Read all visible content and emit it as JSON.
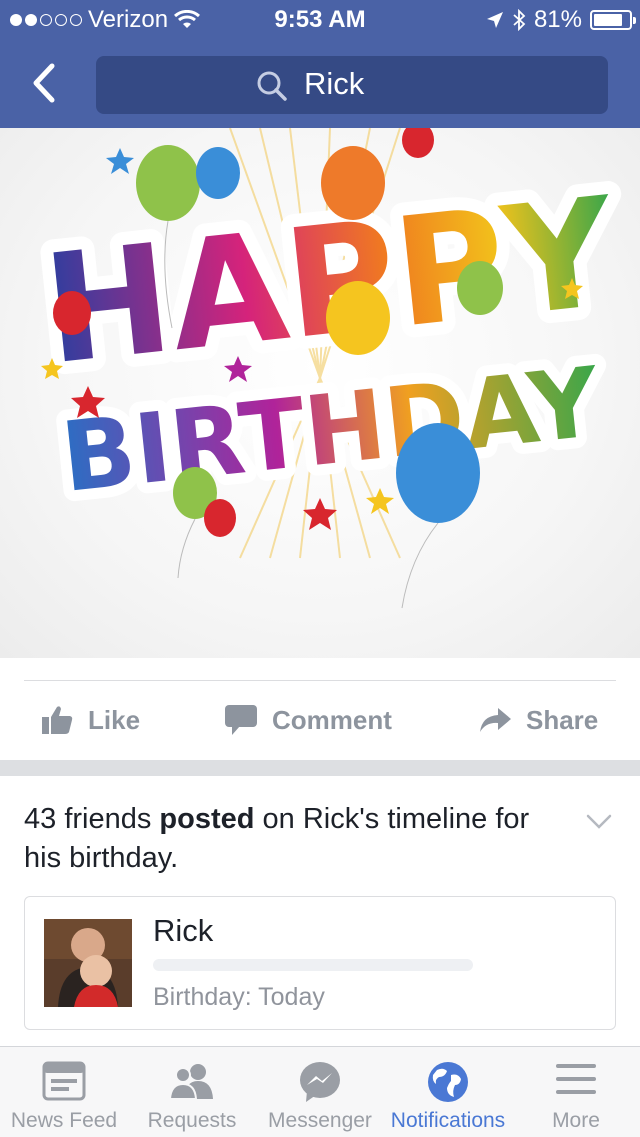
{
  "status_bar": {
    "carrier": "Verizon",
    "time": "9:53 AM",
    "battery": "81%",
    "battery_level": 0.81
  },
  "nav": {
    "search_text": "Rick"
  },
  "post_image": {
    "text_line1": "HAPPY",
    "text_line2": "BIRTHDAY"
  },
  "actions": {
    "like": "Like",
    "comment": "Comment",
    "share": "Share"
  },
  "notification": {
    "count_text": "43 friends",
    "posted": "posted",
    "rest": "on Rick's timeline for his birthday.",
    "card": {
      "name": "Rick",
      "subtitle": "Birthday: Today"
    }
  },
  "tabs": [
    {
      "label": "News Feed",
      "icon": "news-feed-icon",
      "active": false
    },
    {
      "label": "Requests",
      "icon": "friend-requests-icon",
      "active": false
    },
    {
      "label": "Messenger",
      "icon": "messenger-icon",
      "active": false
    },
    {
      "label": "Notifications",
      "icon": "globe-icon",
      "active": true
    },
    {
      "label": "More",
      "icon": "menu-icon",
      "active": false
    }
  ],
  "colors": {
    "brand": "#4a62a6",
    "active_tab": "#4a78d4",
    "inactive": "#9a9ea5"
  }
}
